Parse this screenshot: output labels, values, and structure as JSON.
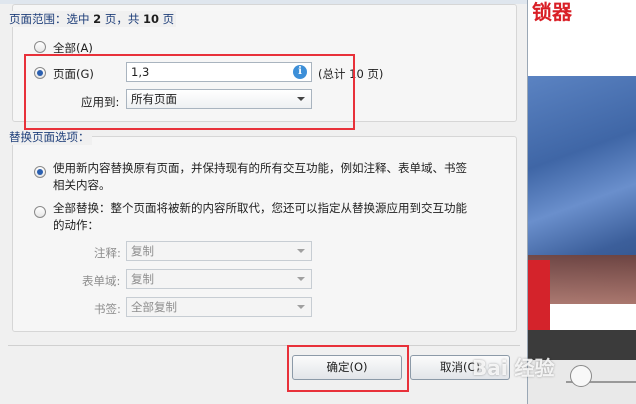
{
  "page_range": {
    "title_prefix": "页面范围：选中",
    "selected_count": "2",
    "title_mid": "页，共",
    "total_count": "10",
    "title_suffix": "页",
    "all_label": "全部(A)",
    "pages_label": "页面(G)",
    "pages_value": "1,3",
    "pages_total": "(总计 10 页)",
    "apply_to_label": "应用到:",
    "apply_to_value": "所有页面",
    "info_glyph": "i"
  },
  "replace_options": {
    "title": "替换页面选项：",
    "option1_line1": "使用新内容替换原有页面，并保持现有的所有交互功能，例如注释、表单域、书签",
    "option1_line2": "相关内容。",
    "option2_line1": "全部替换：整个页面将被新的内容所取代，您还可以指定从替换源应用到交互功能",
    "option2_line2": "的动作：",
    "annotation_label": "注释:",
    "annotation_value": "复制",
    "form_label": "表单域:",
    "form_value": "复制",
    "bookmark_label": "书签:",
    "bookmark_value": "全部复制"
  },
  "buttons": {
    "ok": "确定(O)",
    "cancel": "取消(C)"
  },
  "background": {
    "headline": "锁器",
    "watermark": "Bai 经验"
  },
  "colors": {
    "accent": "#2a5fb0",
    "highlight": "#e8313a"
  }
}
